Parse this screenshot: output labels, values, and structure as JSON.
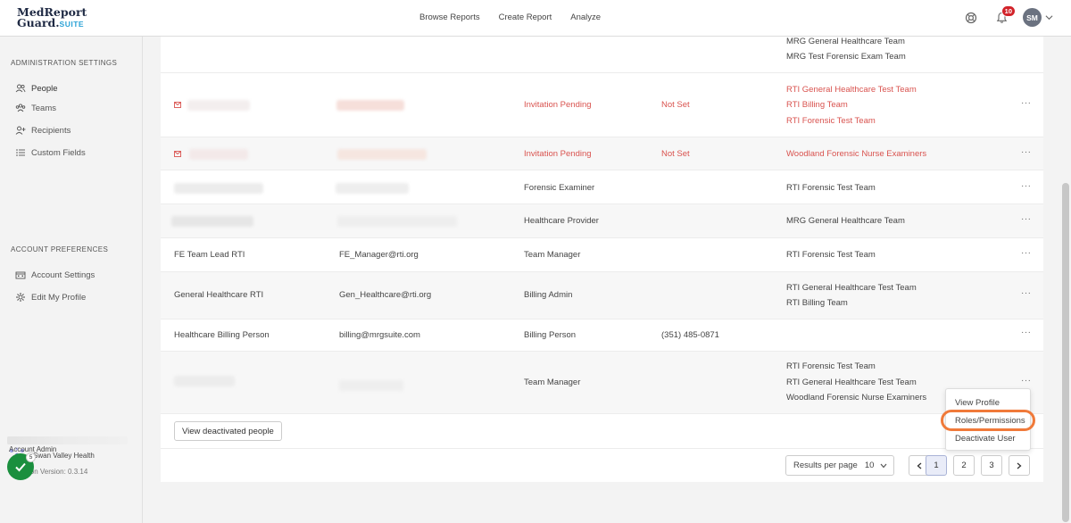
{
  "header": {
    "logo_top": "MedReport",
    "logo_bottom": "Guard.",
    "logo_suite": "SUITE",
    "nav": [
      "Browse Reports",
      "Create Report",
      "Analyze"
    ],
    "notification_count": "10",
    "avatar_initials": "SM"
  },
  "sidebar": {
    "admin_section": "ADMINISTRATION SETTINGS",
    "admin_items": [
      "People",
      "Teams",
      "Recipients",
      "Custom Fields"
    ],
    "account_section": "ACCOUNT PREFERENCES",
    "account_items": [
      "Account Settings",
      "Edit My Profile"
    ],
    "org_name": "Swan Valley Health",
    "role": "Account Admin",
    "version": "ion Version: 0.3.14",
    "task_count": "5"
  },
  "table": {
    "rows": [
      {
        "name": "",
        "email": "",
        "role": "",
        "phone": "",
        "teams": [
          "MRG General Healthcare Team",
          "MRG Test Forensic Exam Team"
        ],
        "pending": false
      },
      {
        "name": "",
        "email": "",
        "role": "Invitation Pending",
        "phone": "Not Set",
        "teams": [
          "RTI General Healthcare Test Team",
          "RTI Billing Team",
          "RTI Forensic Test Team"
        ],
        "pending": true
      },
      {
        "name": "",
        "email": "",
        "role": "Invitation Pending",
        "phone": "Not Set",
        "teams": [
          "Woodland Forensic Nurse Examiners"
        ],
        "pending": true
      },
      {
        "name": "",
        "email": "",
        "role": "Forensic Examiner",
        "phone": "",
        "teams": [
          "RTI Forensic Test Team"
        ],
        "pending": false
      },
      {
        "name": "",
        "email": "",
        "role": "Healthcare Provider",
        "phone": "",
        "teams": [
          "MRG General Healthcare Team"
        ],
        "pending": false
      },
      {
        "name": "FE Team Lead RTI",
        "email": "FE_Manager@rti.org",
        "role": "Team Manager",
        "phone": "",
        "teams": [
          "RTI Forensic Test Team"
        ],
        "pending": false
      },
      {
        "name": "General Healthcare RTI",
        "email": "Gen_Healthcare@rti.org",
        "role": "Billing Admin",
        "phone": "",
        "teams": [
          "RTI General Healthcare Test Team",
          "RTI Billing Team"
        ],
        "pending": false
      },
      {
        "name": "Healthcare Billing Person",
        "email": "billing@mrgsuite.com",
        "role": "Billing Person",
        "phone": "(351) 485-0871",
        "teams": [],
        "pending": false
      },
      {
        "name": "",
        "email": "",
        "role": "Team Manager",
        "phone": "",
        "teams": [
          "RTI Forensic Test Team",
          "RTI General Healthcare Test Team",
          "Woodland Forensic Nurse Examiners"
        ],
        "pending": false
      }
    ],
    "more_label": "···"
  },
  "actions": {
    "view_deactivated": "View deactivated people"
  },
  "pagination": {
    "results_per_page_label": "Results per page",
    "results_per_page_value": "10",
    "pages": [
      "1",
      "2",
      "3"
    ],
    "current_page": "1"
  },
  "row_menu": {
    "items": [
      "View Profile",
      "Roles/Permissions",
      "Deactivate User"
    ],
    "highlighted": "Roles/Permissions"
  },
  "colors": {
    "pending": "#d9534f",
    "highlight": "#f07a3a",
    "success": "#1a8f3e"
  }
}
